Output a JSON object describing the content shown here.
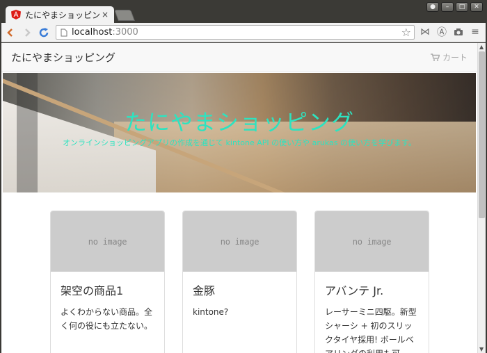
{
  "tab": {
    "title": "たにやまショッピング",
    "close": "×"
  },
  "address": {
    "host": "localhost",
    "port": ":3000"
  },
  "navbar": {
    "brand": "たにやまショッピング",
    "cart_label": "カート"
  },
  "hero": {
    "title": "たにやまショッピング",
    "subtitle": "オンラインショッピングアプリの作成を通じて kintone API の使い方や arukas の使い方を学びます。"
  },
  "products": [
    {
      "image_placeholder": "no image",
      "name": "架空の商品1",
      "description": "よくわからない商品。全く何の役にも立たない。"
    },
    {
      "image_placeholder": "no image",
      "name": "金豚",
      "description": "kintone?"
    },
    {
      "image_placeholder": "no image",
      "name": "アバンテ Jr.",
      "description": "レーサーミニ四駆。新型シャーシ + 初のスリックタイヤ採用! ボールベアリングの利用も可。"
    }
  ],
  "colors": {
    "hero_text": "#2de3c0",
    "chrome_dark": "#3b3a36"
  }
}
